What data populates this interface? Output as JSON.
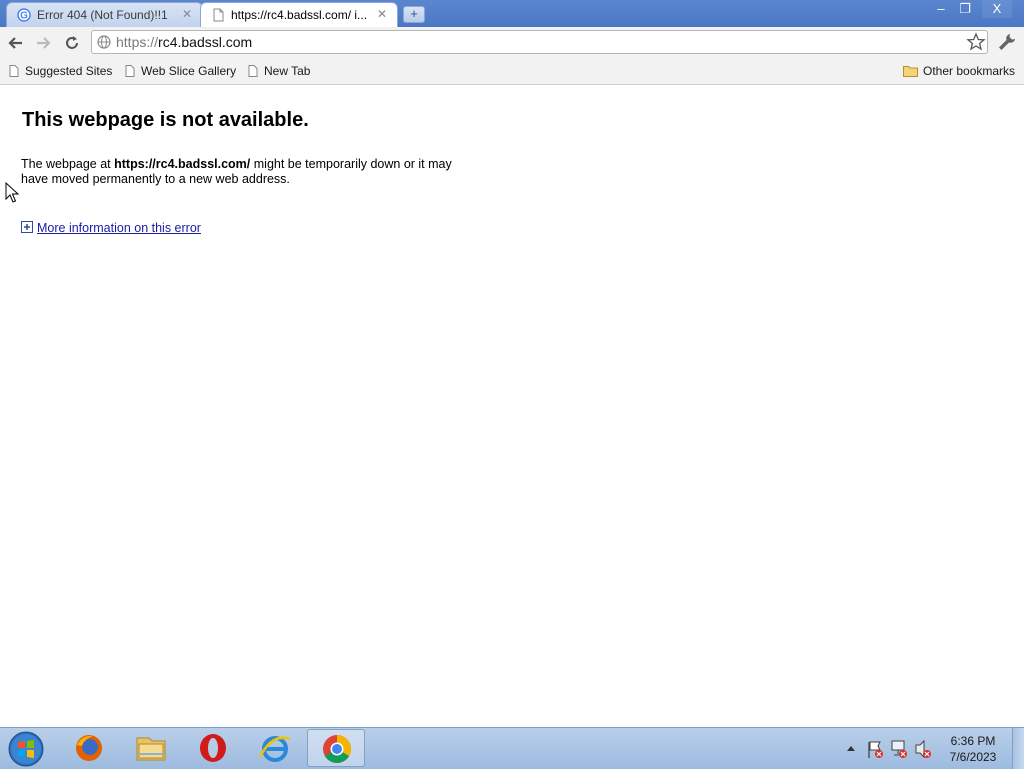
{
  "tabs": [
    {
      "title": "Error 404 (Not Found)!!1",
      "favicon": "google-icon",
      "active": false
    },
    {
      "title": "https://rc4.badssl.com/ i...",
      "favicon": "page-icon",
      "active": true
    }
  ],
  "window_controls": {
    "minimize": "–",
    "maximize": "❐",
    "close": "X"
  },
  "omnibox": {
    "scheme": "https://",
    "host": "rc4.badssl.com"
  },
  "bookmarks": [
    {
      "label": "Suggested Sites"
    },
    {
      "label": "Web Slice Gallery"
    },
    {
      "label": "New Tab"
    }
  ],
  "other_bookmarks": "Other bookmarks",
  "error_page": {
    "heading": "This webpage is not available.",
    "desc_prefix": "The webpage at ",
    "desc_url": "https://rc4.badssl.com/",
    "desc_suffix": " might be temporarily down or it may have moved permanently to a new web address.",
    "more_info": "More information on this error"
  },
  "taskbar": {
    "apps": [
      "firefox-icon",
      "file-explorer-icon",
      "opera-icon",
      "internet-explorer-icon",
      "chrome-icon"
    ],
    "time": "6:36 PM",
    "date": "7/6/2023"
  },
  "colors": {
    "accent": "#4a77c4",
    "link": "#1c1ca6"
  }
}
